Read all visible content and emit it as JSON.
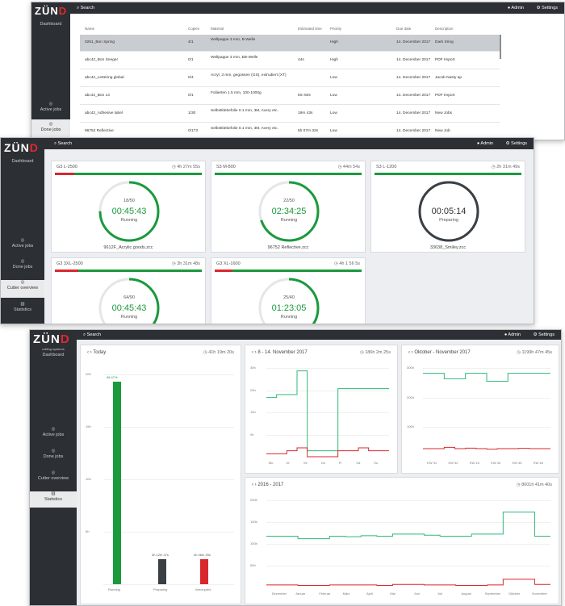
{
  "brand": {
    "logo": "ZÜND",
    "tagline": "cutting systems",
    "side_title": "Dashboard",
    "accent": "#e2282d",
    "green": "#1a9a3c",
    "red": "#d9272e"
  },
  "sidebar": {
    "active_jobs": "Active jobs",
    "done_jobs": "Done jobs",
    "cutter_overview": "Cutter overview",
    "statistics": "Statistics"
  },
  "topbar": {
    "search": "Search",
    "admin": "Admin",
    "settings": "Settings"
  },
  "jobs_table": {
    "headers": [
      "Name",
      "Copies",
      "Material",
      "Estimated time",
      "Priority",
      "Due date",
      "Description"
    ],
    "rows": [
      {
        "name": "0251_Bon Spring",
        "copies": "4/1",
        "material": "Wellpappe 3 mm, B-Welle",
        "time": "",
        "priority": "High",
        "due": "14. December 2017",
        "desc": "Dark Sring"
      },
      {
        "name": "abc42_Bon Sneger",
        "copies": "0/1",
        "material": "Wellpappe 3 mm, EB-Welle",
        "time": "44s",
        "priority": "High",
        "due": "14. December 2017",
        "desc": "PDF Import"
      },
      {
        "name": "abc42_Lettering global",
        "copies": "0/4",
        "material": "Acryl, 3 mm, gegossen (GS), extrudiert (XT)",
        "time": "",
        "priority": "Low",
        "due": "14. December 2017",
        "desc": "Jacob Nasty ap"
      },
      {
        "name": "abc42_Bon 14",
        "copies": "0/1",
        "material": "Foliierten 1.5 mm, 100-1000g",
        "time": "5m 50s",
        "priority": "Low",
        "due": "14. December 2017",
        "desc": "PDF Import"
      },
      {
        "name": "abc42_Adhesive label",
        "copies": "1/30",
        "material": "Selbstklebefolie 0.1 mm, 3M, Avery etc.",
        "time": "19m 43s",
        "priority": "Low",
        "due": "14. December 2017",
        "desc": "New Jobs"
      },
      {
        "name": "96752 Reflective",
        "copies": "0/173",
        "material": "Selbstklebefolie 0.1 mm, 3M, Avery etc.",
        "time": "5h 07m 32s",
        "priority": "Low",
        "due": "14. December 2017",
        "desc": "New Job"
      }
    ]
  },
  "cutters": [
    {
      "name": "G3 L-2500",
      "total": "4h 27m 55s",
      "progress": 0.13,
      "count": "18/50",
      "time": "00:45:43",
      "status": "Running",
      "file": "9612F_Acrylic goods.zcc",
      "ring": 0.75
    },
    {
      "name": "S3 M-800",
      "total": "44m 54s",
      "progress": 0.0,
      "count": "22/50",
      "time": "02:34:25",
      "status": "Running",
      "file": "96752 Reflective.zcc",
      "ring": 0.7
    },
    {
      "name": "S3 L-1200",
      "total": "2h 31m 49s",
      "progress": 0.0,
      "count": "",
      "time": "00:05:14",
      "status": "Preparing",
      "file": "33638_Smiley.zcc",
      "ring": 1.0
    },
    {
      "name": "G3 3XL-2500",
      "total": "3h 31m 48s",
      "progress": 0.16,
      "count": "64/90",
      "time": "00:45:43",
      "status": "Running",
      "file": "",
      "ring": 0.55
    },
    {
      "name": "G3 XL-1600",
      "total": "4h 1 56 5s",
      "progress": 0.12,
      "count": "25/40",
      "time": "01:23:05",
      "status": "Running",
      "file": "",
      "ring": 0.6
    }
  ],
  "stats": {
    "today": {
      "title": "Today",
      "total": "41h 19m 20s",
      "bars": [
        {
          "label": "Running",
          "value": 96.47,
          "tag": "96.47%",
          "color": "#1a9a3c"
        },
        {
          "label": "Preparing",
          "value": 12,
          "tag": "3h 12m 47s",
          "color": "#3a3f44"
        },
        {
          "label": "Interrupted",
          "value": 12,
          "tag": "4h 46m 25s",
          "color": "#d9272e"
        }
      ],
      "yticks": [
        "20h",
        "15h",
        "10h",
        "5h",
        ""
      ]
    },
    "week": {
      "title": "8 - 14. November 2017",
      "total": "186h 2m 25s",
      "xlabels": [
        "Mo",
        "Di",
        "Mi",
        "Do",
        "Fr",
        "Sa",
        "So"
      ],
      "yticks": [
        "30h",
        "20h",
        "10h",
        "0h"
      ]
    },
    "months": {
      "title": "Oktober - November 2017",
      "total": "1199h 47m 45s",
      "xlabels": [
        "KW 41",
        "KW 42",
        "KW 43",
        "KW 44",
        "KW 45",
        "KW 46"
      ],
      "yticks": [
        "300h",
        "200h",
        "100h"
      ]
    },
    "year": {
      "title": "2016 - 2017",
      "total": "8001h 41m 40s",
      "xlabels": [
        "Dezember",
        "Januar",
        "Februar",
        "März",
        "April",
        "Mai",
        "Juni",
        "Juli",
        "August",
        "September",
        "Oktober",
        "November"
      ],
      "yticks": [
        "200h",
        "150h",
        "100h",
        "50h"
      ]
    }
  }
}
